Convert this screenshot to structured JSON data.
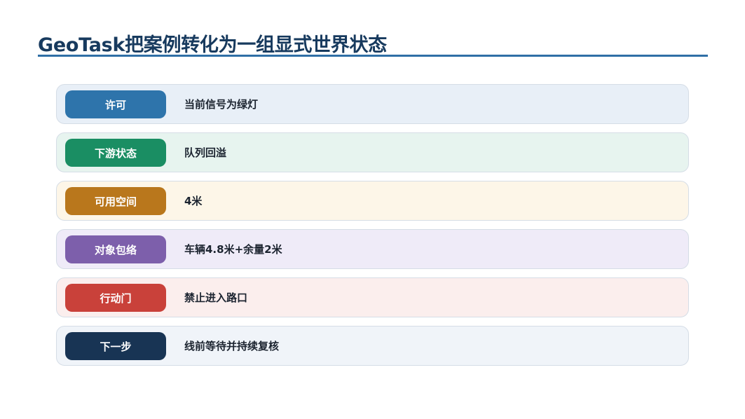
{
  "slide": {
    "title": "GeoTask把案例转化为一组显式世界状态"
  },
  "rows": [
    {
      "label": "许可",
      "value": "当前信号为绿灯",
      "color": "#2e74ab"
    },
    {
      "label": "下游状态",
      "value": "队列回溢",
      "color": "#1a8e63"
    },
    {
      "label": "可用空间",
      "value": "4米",
      "color": "#b9771c"
    },
    {
      "label": "对象包络",
      "value": "车辆4.8米+余量2米",
      "color": "#7d5fab"
    },
    {
      "label": "行动门",
      "value": "禁止进入路口",
      "color": "#c9413a"
    },
    {
      "label": "下一步",
      "value": "线前等待并持续复核",
      "color": "#183454"
    }
  ]
}
